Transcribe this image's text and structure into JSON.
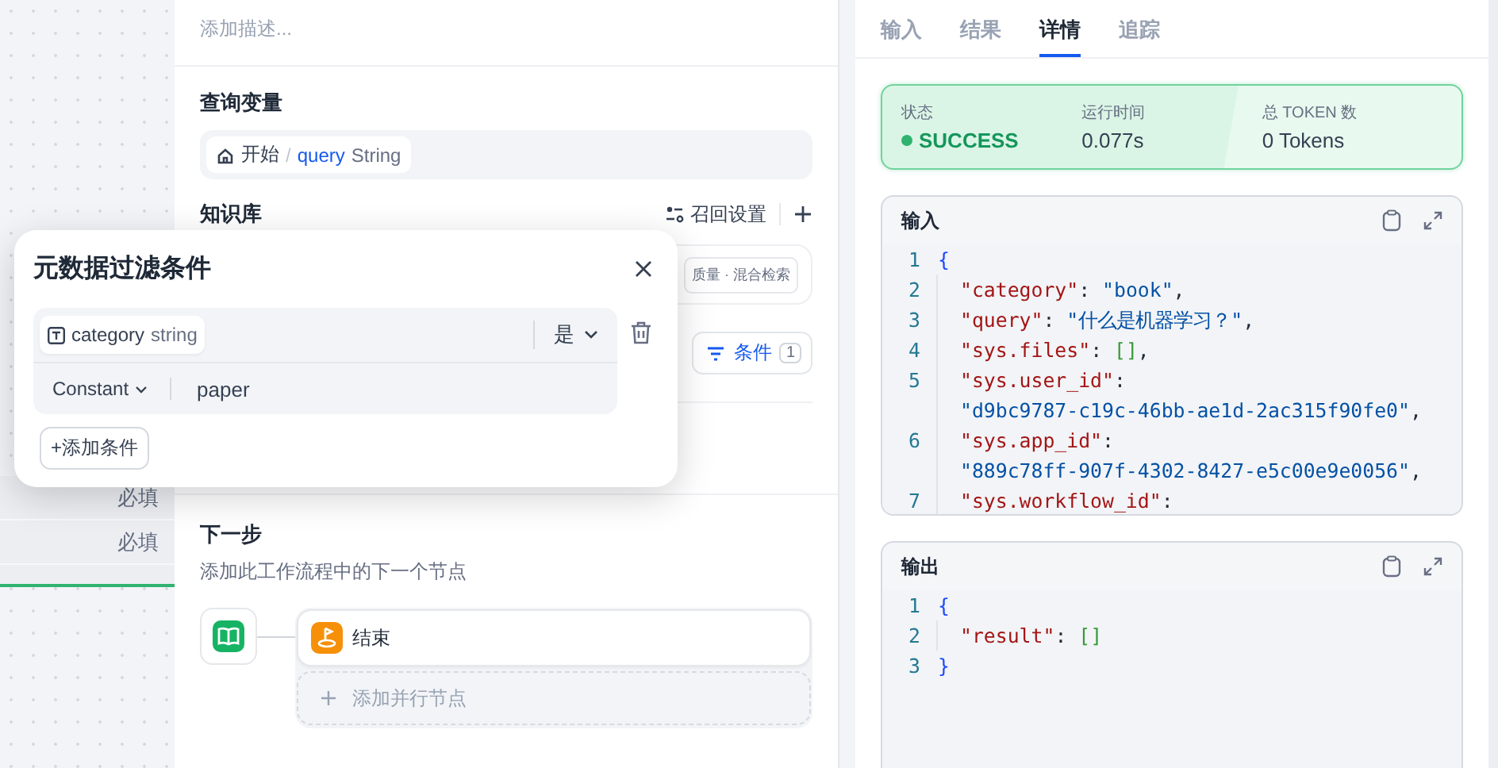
{
  "canvas": {
    "required_labels": [
      "必填",
      "必填"
    ]
  },
  "node_panel": {
    "description_placeholder": "添加描述...",
    "query_variable": {
      "title": "查询变量",
      "source": "开始",
      "separator": "/",
      "name": "query",
      "type": "String"
    },
    "knowledge": {
      "title": "知识库",
      "recall_settings": "召回设置",
      "item_tag": "质量 · 混合检索",
      "condition_button": {
        "label": "条件",
        "count": "1"
      }
    },
    "next_step": {
      "title": "下一步",
      "subtitle": "添加此工作流程中的下一个节点",
      "nodes": [
        {
          "label": "结束"
        }
      ],
      "add_parallel": "添加并行节点"
    }
  },
  "filter_dialog": {
    "title": "元数据过滤条件",
    "conditions": [
      {
        "field": "category",
        "type": "string",
        "operator": "是",
        "value_source": "Constant",
        "value": "paper"
      }
    ],
    "add_button": "+添加条件"
  },
  "result_panel": {
    "tabs": [
      {
        "label": "输入",
        "selected": false
      },
      {
        "label": "结果",
        "selected": false
      },
      {
        "label": "详情",
        "selected": true
      },
      {
        "label": "追踪",
        "selected": false
      }
    ],
    "status": {
      "success": true,
      "label": "状态",
      "value": "SUCCESS",
      "time_label": "运行时间",
      "time": "0.077s",
      "tokens_label": "总 TOKEN 数",
      "tokens": "0 Tokens"
    },
    "input": {
      "title": "输入",
      "lines": [
        {
          "number": "1",
          "tokens": [
            {
              "kind": "brace",
              "text": "{"
            }
          ]
        },
        {
          "number": "2",
          "tokens": [
            {
              "kind": "key",
              "text": "\"category\""
            },
            {
              "kind": "punct",
              "text": ": "
            },
            {
              "kind": "string",
              "text": "\"book\""
            },
            {
              "kind": "punct",
              "text": ","
            }
          ]
        },
        {
          "number": "3",
          "tokens": [
            {
              "kind": "key",
              "text": "\"query\""
            },
            {
              "kind": "punct",
              "text": ": "
            },
            {
              "kind": "string",
              "text": "\"什么是机器学习？\""
            },
            {
              "kind": "punct",
              "text": ","
            }
          ]
        },
        {
          "number": "4",
          "tokens": [
            {
              "kind": "key",
              "text": "\"sys.files\""
            },
            {
              "kind": "punct",
              "text": ": "
            },
            {
              "kind": "bracket",
              "text": "[]"
            },
            {
              "kind": "punct",
              "text": ","
            }
          ]
        },
        {
          "number": "5",
          "tokens": [
            {
              "kind": "key",
              "text": "\"sys.user_id\""
            },
            {
              "kind": "punct",
              "text": ":"
            }
          ]
        },
        {
          "tokens": [
            {
              "kind": "string",
              "text": "\"d9bc9787-c19c-46bb-ae1d-2ac315f90fe0\""
            },
            {
              "kind": "punct",
              "text": ","
            }
          ]
        },
        {
          "number": "6",
          "tokens": [
            {
              "kind": "key",
              "text": "\"sys.app_id\""
            },
            {
              "kind": "punct",
              "text": ":"
            }
          ]
        },
        {
          "tokens": [
            {
              "kind": "string",
              "text": "\"889c78ff-907f-4302-8427-e5c00e9e0056\""
            },
            {
              "kind": "punct",
              "text": ","
            }
          ]
        },
        {
          "number": "7",
          "tokens": [
            {
              "kind": "key",
              "text": "\"sys.workflow_id\""
            },
            {
              "kind": "punct",
              "text": ":"
            }
          ]
        }
      ]
    },
    "output": {
      "title": "输出",
      "lines": [
        {
          "number": "1",
          "tokens": [
            {
              "kind": "brace",
              "text": "{"
            }
          ]
        },
        {
          "number": "2",
          "tokens": [
            {
              "kind": "key",
              "text": "\"result\""
            },
            {
              "kind": "punct",
              "text": ": "
            },
            {
              "kind": "bracket",
              "text": "[]"
            }
          ]
        },
        {
          "number": "3",
          "tokens": [
            {
              "kind": "brace",
              "text": "}"
            }
          ]
        }
      ]
    }
  }
}
